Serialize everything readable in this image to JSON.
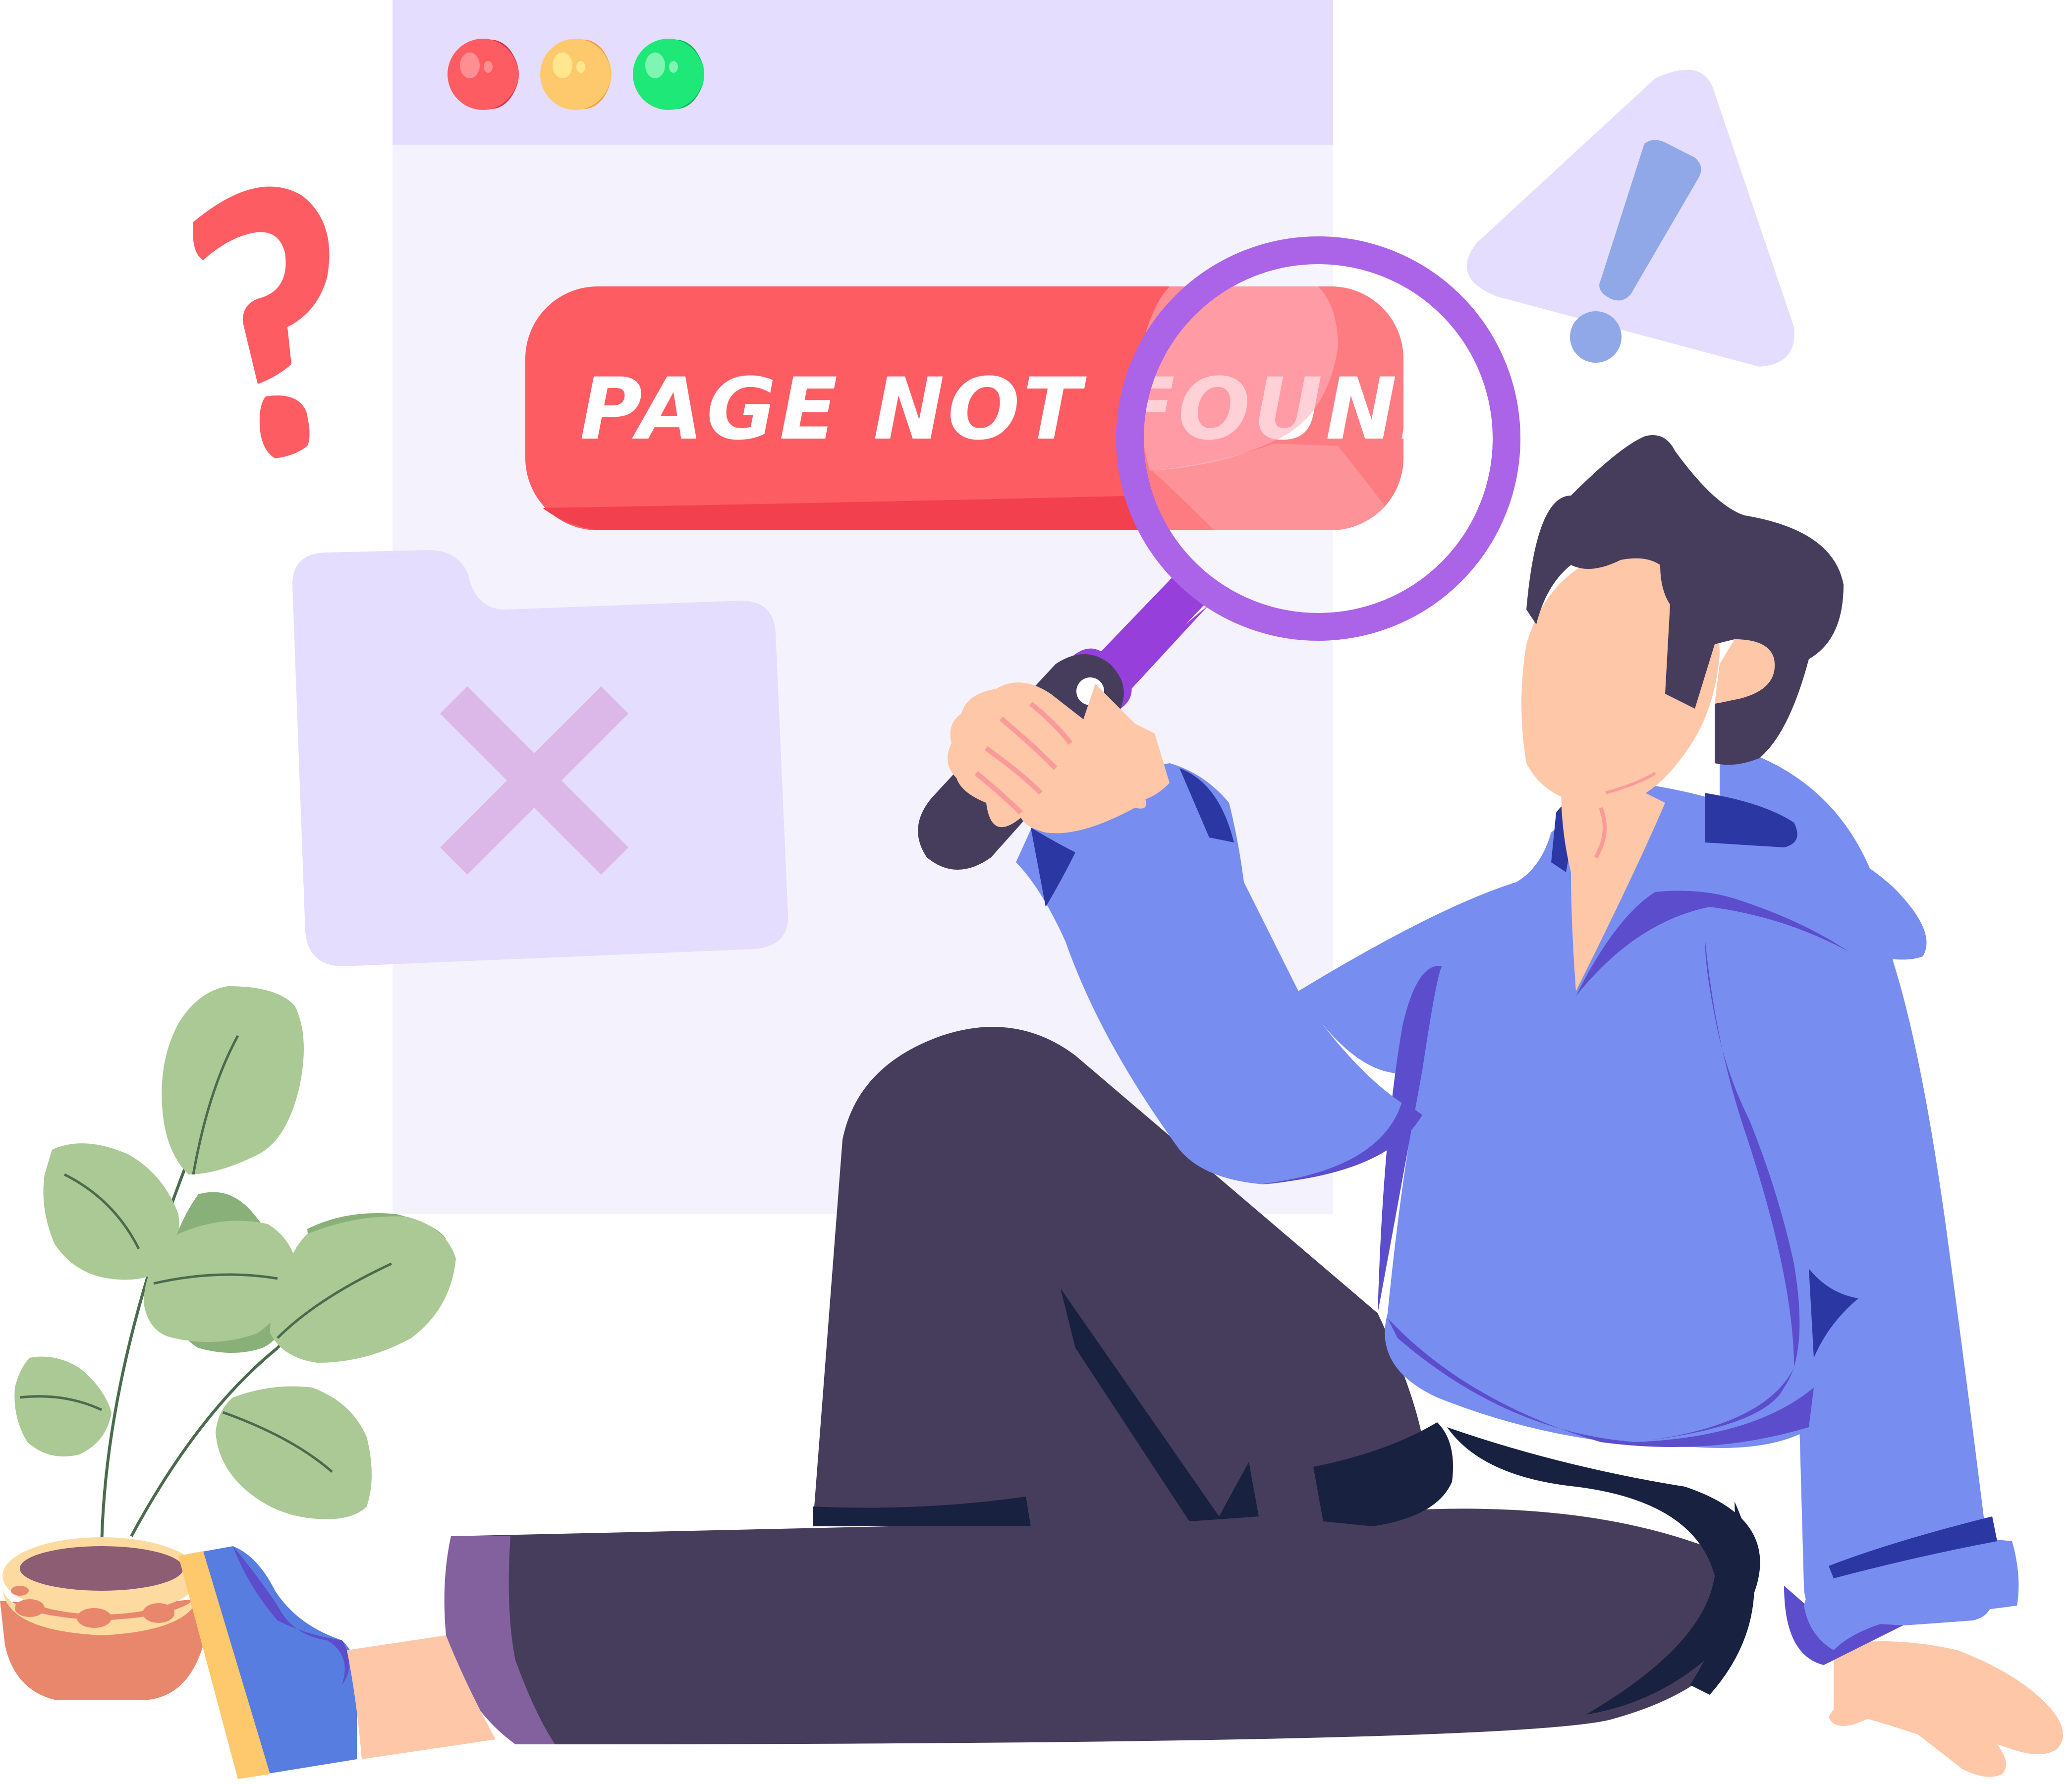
{
  "browser_window": {
    "title_bar_buttons": [
      "close",
      "minimize",
      "maximize"
    ]
  },
  "error_banner": {
    "text": "PAGE NOT FOUND"
  },
  "icons": {
    "question": "question-mark-icon",
    "warning": "warning-triangle-icon",
    "folder": "folder-error-icon",
    "magnifier": "magnifying-glass-icon"
  },
  "colors": {
    "window_bar": "#e4ddfd",
    "window_body": "#f4f3fd",
    "banner": "#fd5c63",
    "question_mark": "#fd5c63",
    "warning_bg": "#e4ddfd",
    "warning_mark": "#90a8e8",
    "magnifier": "#ab64e8",
    "hoodie": "#788df0",
    "pants": "#463d5c",
    "hair": "#463d5c",
    "skin": "#fdc7a8",
    "plant_leaf": "#abc994"
  }
}
